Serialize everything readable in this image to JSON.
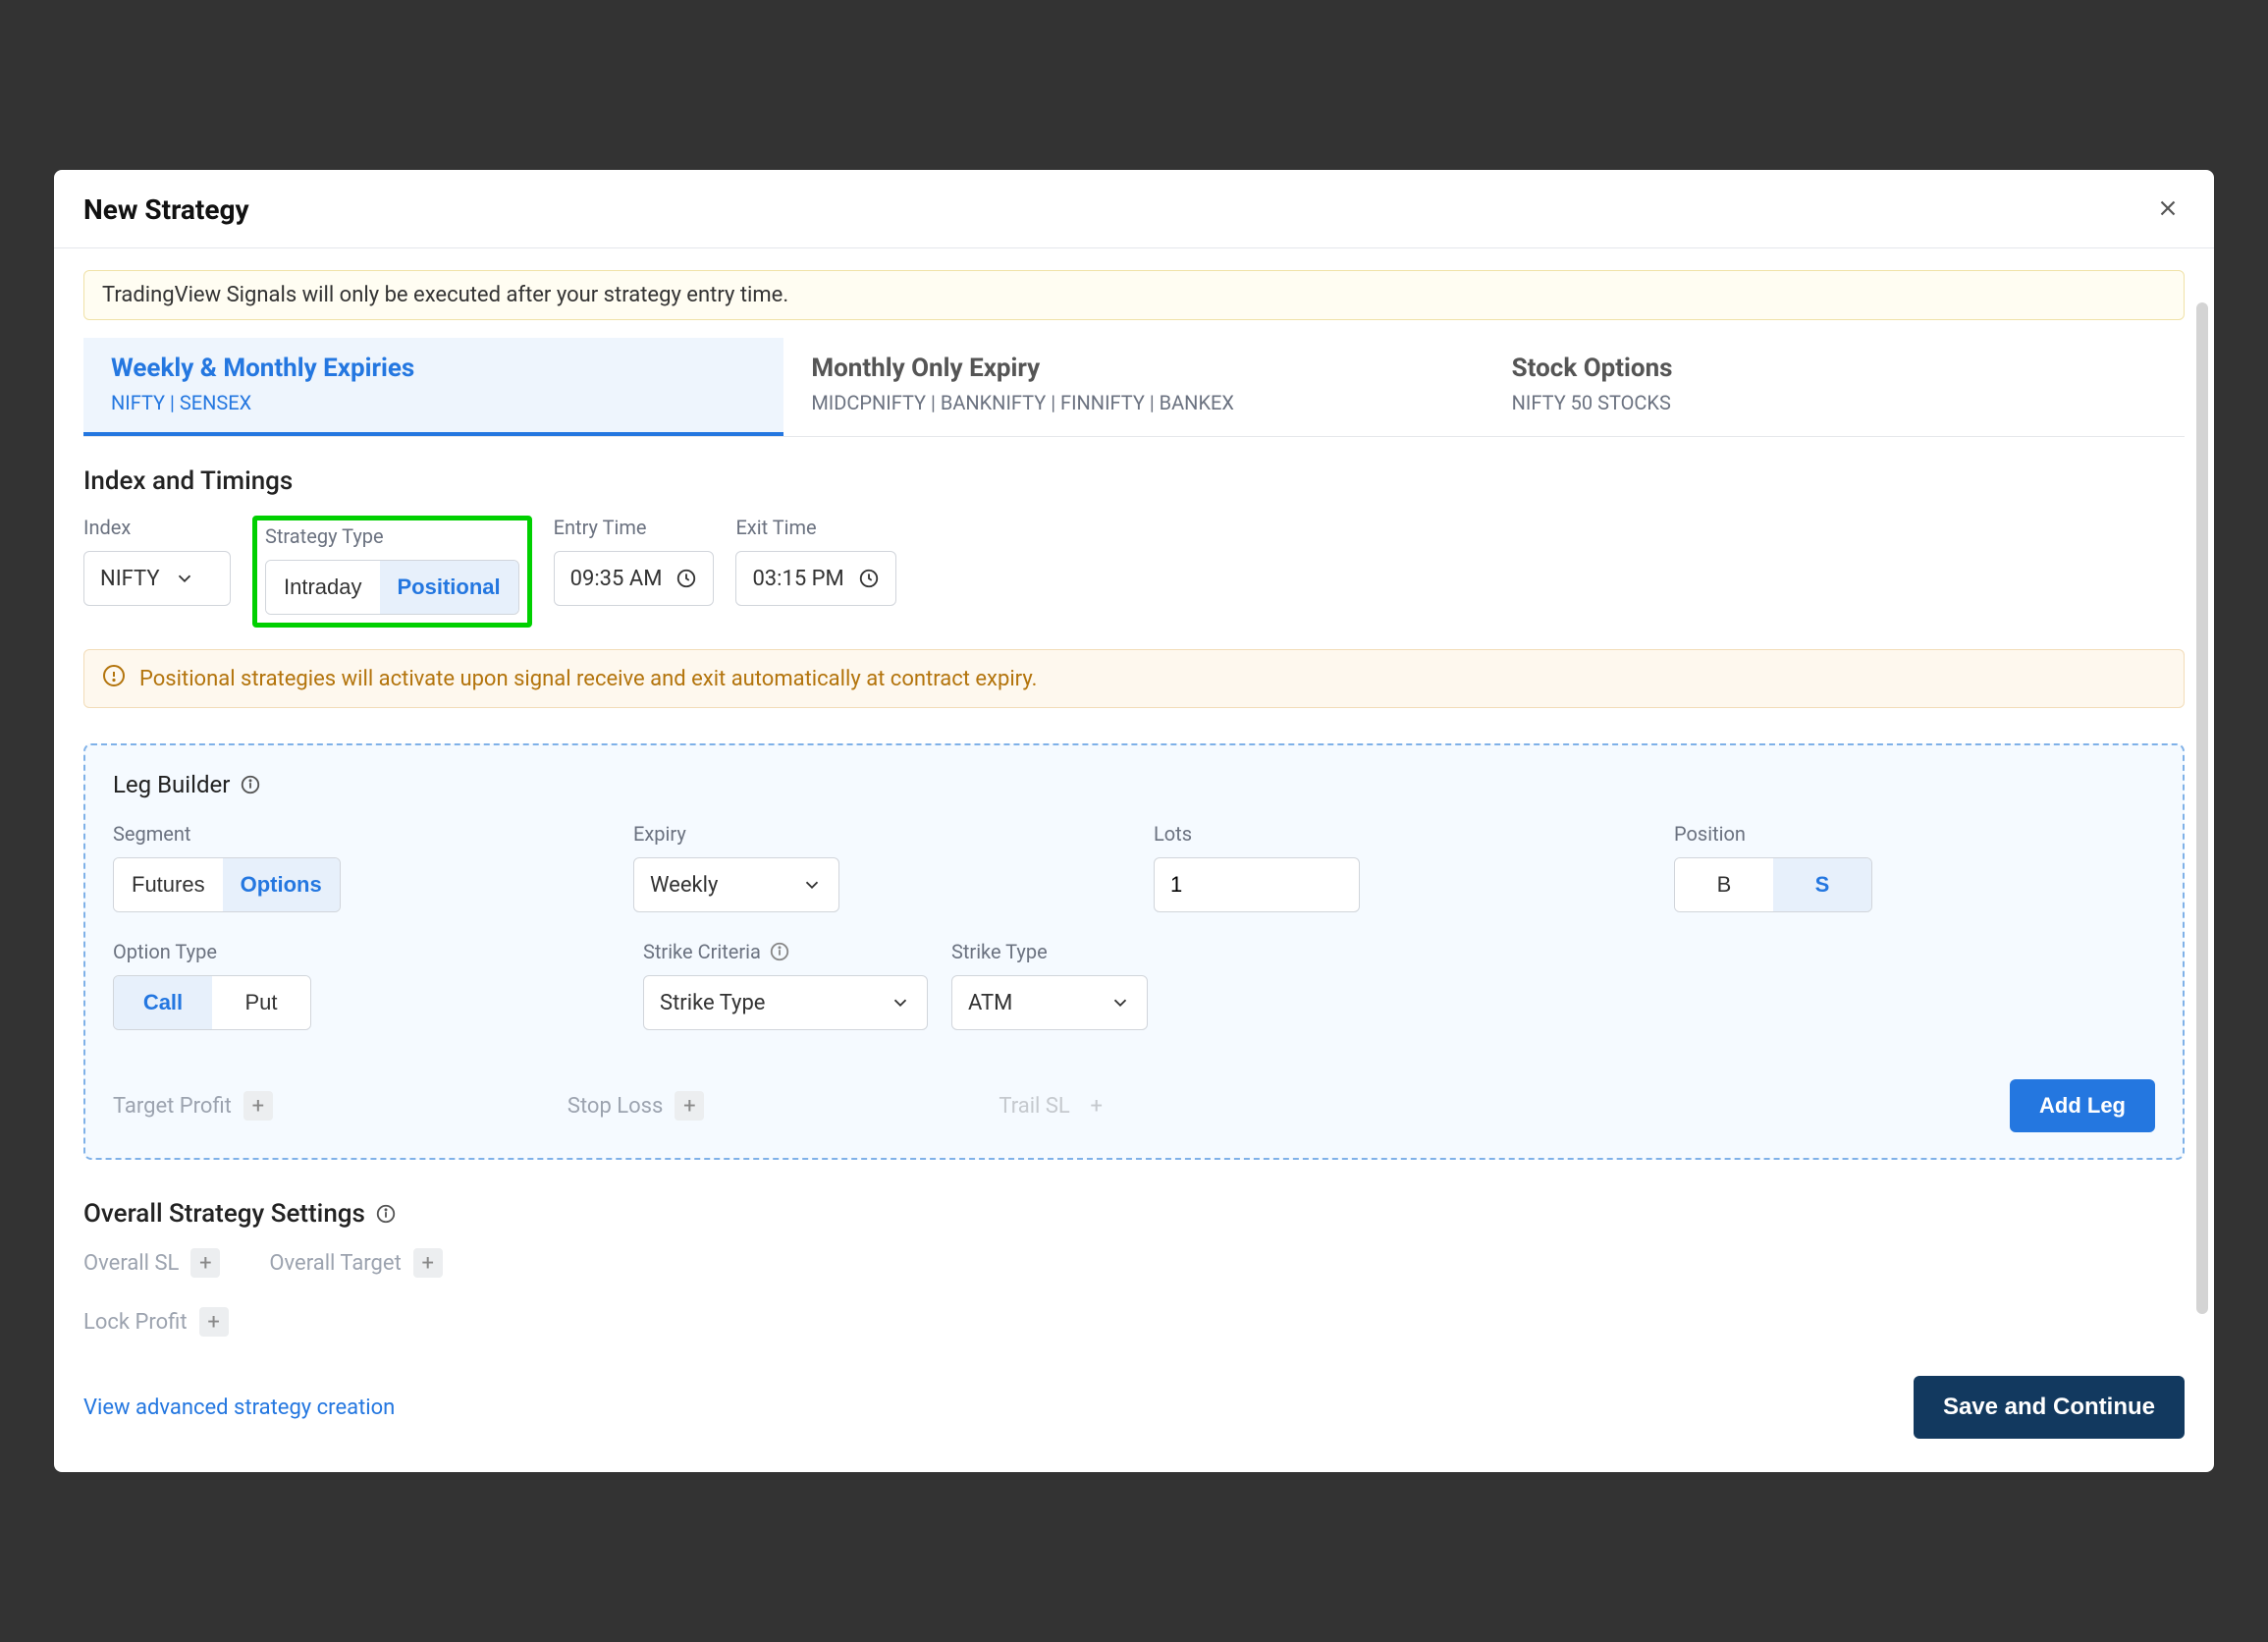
{
  "modal": {
    "title": "New Strategy"
  },
  "banner": {
    "signal_info": "TradingView Signals will only be executed after your strategy entry time."
  },
  "tabs": [
    {
      "title": "Weekly & Monthly Expiries",
      "sub": "NIFTY | SENSEX",
      "active": true
    },
    {
      "title": "Monthly Only Expiry",
      "sub": "MIDCPNIFTY | BANKNIFTY | FINNIFTY | BANKEX",
      "active": false
    },
    {
      "title": "Stock Options",
      "sub": "NIFTY 50 STOCKS",
      "active": false
    }
  ],
  "index_timings": {
    "heading": "Index and Timings",
    "labels": {
      "index": "Index",
      "strategy_type": "Strategy Type",
      "entry_time": "Entry Time",
      "exit_time": "Exit Time"
    },
    "index_value": "NIFTY",
    "strategy_type": {
      "intraday": "Intraday",
      "positional": "Positional",
      "selected": "positional"
    },
    "entry_time": "09:35 AM",
    "exit_time": "03:15 PM"
  },
  "warning": "Positional strategies will activate upon signal receive and exit automatically at contract expiry.",
  "leg_builder": {
    "heading": "Leg Builder",
    "labels": {
      "segment": "Segment",
      "expiry": "Expiry",
      "lots": "Lots",
      "position": "Position",
      "option_type": "Option Type",
      "strike_criteria": "Strike Criteria",
      "strike_type": "Strike Type"
    },
    "segment": {
      "futures": "Futures",
      "options": "Options",
      "selected": "options"
    },
    "expiry": "Weekly",
    "lots": "1",
    "position": {
      "b": "B",
      "s": "S",
      "selected": "s"
    },
    "option_type": {
      "call": "Call",
      "put": "Put",
      "selected": "call"
    },
    "strike_criteria_value": "Strike Type",
    "strike_type_value": "ATM",
    "footer": {
      "target_profit": "Target Profit",
      "stop_loss": "Stop Loss",
      "trail_sl": "Trail SL",
      "add_leg": "Add Leg"
    }
  },
  "overall": {
    "heading": "Overall Strategy Settings",
    "overall_sl": "Overall SL",
    "overall_target": "Overall Target",
    "lock_profit": "Lock Profit"
  },
  "footer": {
    "advanced_link": "View advanced strategy creation",
    "save": "Save and Continue"
  }
}
